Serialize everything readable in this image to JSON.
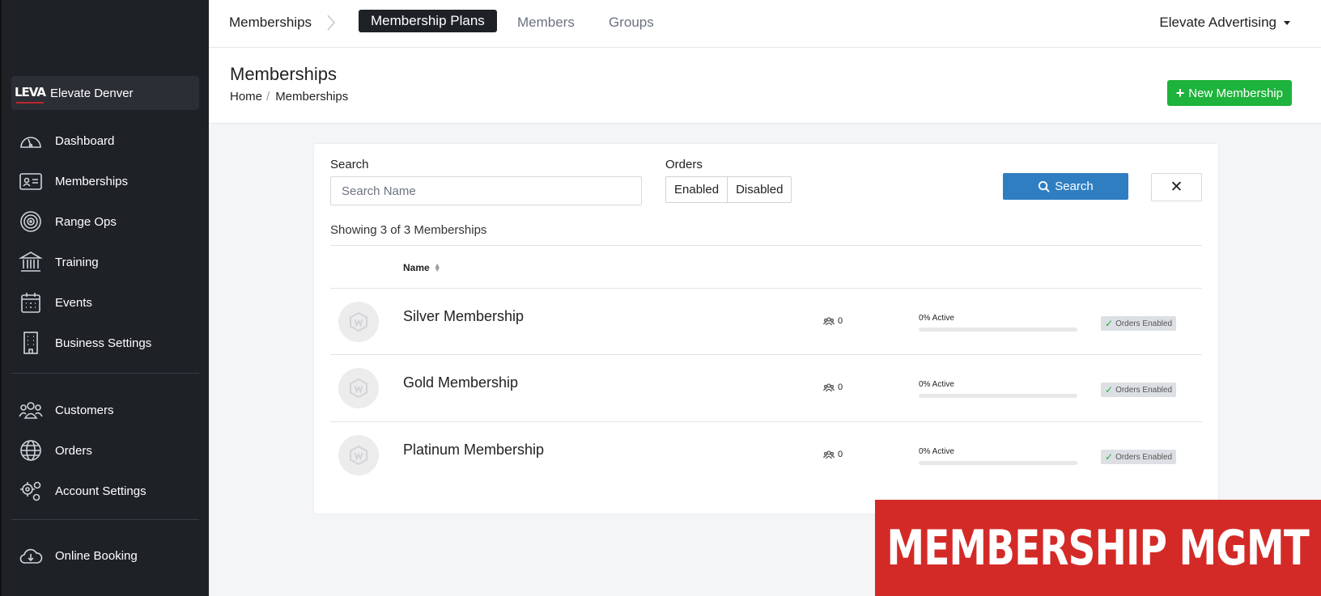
{
  "sidebar": {
    "org": {
      "logo_text": "LEVA",
      "name": "Elevate Denver"
    },
    "items": [
      {
        "label": "Dashboard",
        "icon": "gauge-icon"
      },
      {
        "label": "Memberships",
        "icon": "id-card-icon"
      },
      {
        "label": "Range Ops",
        "icon": "target-icon"
      },
      {
        "label": "Training",
        "icon": "bank-icon"
      },
      {
        "label": "Events",
        "icon": "calendar-icon"
      },
      {
        "label": "Business Settings",
        "icon": "building-icon"
      },
      {
        "label": "Customers",
        "icon": "people-icon"
      },
      {
        "label": "Orders",
        "icon": "globe-icon"
      },
      {
        "label": "Account Settings",
        "icon": "gears-icon"
      },
      {
        "label": "Online Booking",
        "icon": "cloud-download-icon"
      }
    ]
  },
  "topbar": {
    "root": "Memberships",
    "tabs": [
      "Membership Plans",
      "Members",
      "Groups"
    ],
    "active_tab": "Membership Plans",
    "account": "Elevate Advertising"
  },
  "header": {
    "title": "Memberships",
    "breadcrumb": [
      "Home",
      "Memberships"
    ],
    "new_button": "New Membership"
  },
  "filters": {
    "search_label": "Search",
    "search_placeholder": "Search Name",
    "search_value": "",
    "orders_label": "Orders",
    "orders_options": [
      "Enabled",
      "Disabled"
    ],
    "search_button": "Search",
    "clear_button": "✕"
  },
  "table": {
    "showing": "Showing 3 of 3 Memberships",
    "name_header": "Name",
    "rows": [
      {
        "name": "Silver Membership",
        "members": "0",
        "active": "0% Active",
        "active_fraction": 0,
        "status": "Orders Enabled"
      },
      {
        "name": "Gold Membership",
        "members": "0",
        "active": "0% Active",
        "active_fraction": 0,
        "status": "Orders Enabled"
      },
      {
        "name": "Platinum Membership",
        "members": "0",
        "active": "0% Active",
        "active_fraction": 0,
        "status": "Orders Enabled"
      }
    ]
  },
  "banner": {
    "text": "MEMBERSHIP MGMT"
  },
  "colors": {
    "sidebar_bg": "#1e2126",
    "primary": "#2f7ec1",
    "success": "#1eb33c",
    "banner": "#d42a27"
  }
}
